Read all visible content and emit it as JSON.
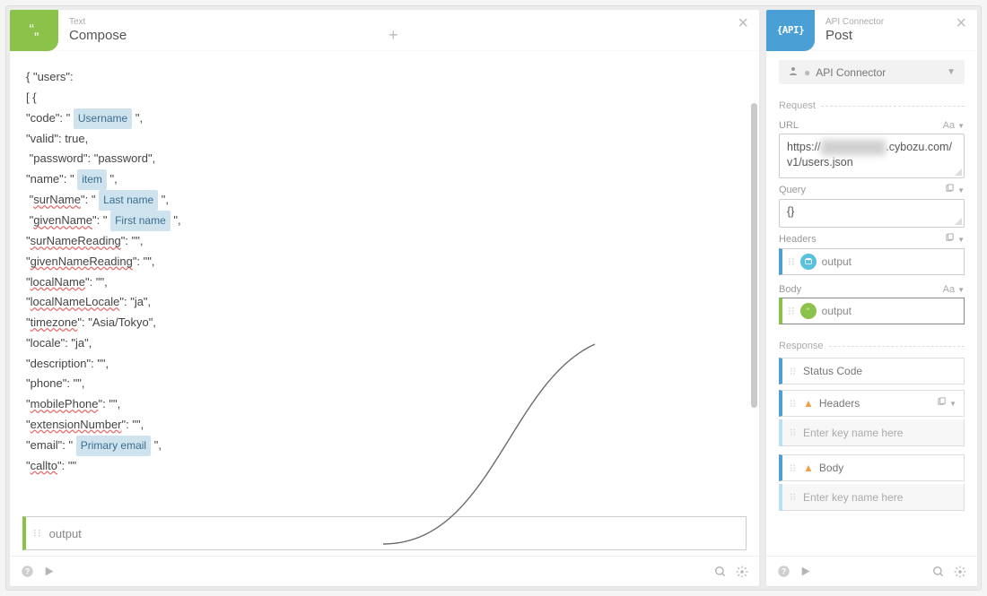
{
  "left": {
    "category": "Text",
    "title": "Compose",
    "lines": [
      {
        "pre": "{ \"users\":"
      },
      {
        "pre": "[ {"
      },
      {
        "pre": "\"code\": \" ",
        "token": "Username",
        "post": " \","
      },
      {
        "pre": "\"valid\": true,"
      },
      {
        "pre": " \"password\": \"password\","
      },
      {
        "pre": "\"name\": \" ",
        "token": "item",
        "post": " \","
      },
      {
        "pre": " \"",
        "err": "surName",
        "mid": "\": \" ",
        "token": "Last name",
        "post": " \","
      },
      {
        "pre": " \"",
        "err": "givenName",
        "mid": "\": \" ",
        "token": "First name",
        "post": " \","
      },
      {
        "pre": "\"",
        "err": "surNameReading",
        "mid": "\": \"\","
      },
      {
        "pre": "\"",
        "err": "givenNameReading",
        "mid": "\": \"\","
      },
      {
        "pre": "\"",
        "err": "localName",
        "mid": "\": \"\","
      },
      {
        "pre": "\"",
        "err": "localNameLocale",
        "mid": "\": \"ja\","
      },
      {
        "pre": "\"",
        "err": "timezone",
        "mid": "\": \"Asia/Tokyo\","
      },
      {
        "pre": "\"locale\": \"ja\","
      },
      {
        "pre": "\"description\": \"\","
      },
      {
        "pre": "\"phone\": \"\","
      },
      {
        "pre": "\"",
        "err": "mobilePhone",
        "mid": "\": \"\","
      },
      {
        "pre": "\"",
        "err": "extensionNumber",
        "mid": "\": \"\","
      },
      {
        "pre": "\"email\": \" ",
        "token": "Primary email",
        "post": " \","
      },
      {
        "pre": "\"",
        "err": "callto",
        "mid": "\": \"\""
      }
    ],
    "output_label": "output"
  },
  "right": {
    "category": "API Connector",
    "title": "Post",
    "connector_select": "API Connector",
    "section_request": "Request",
    "url_label": "URL",
    "url_value_pre": "https://",
    "url_value_post": ".cybozu.com/v1/users.json",
    "query_label": "Query",
    "query_value": "{}",
    "headers_label": "Headers",
    "headers_output": "output",
    "body_label": "Body",
    "body_output": "output",
    "section_response": "Response",
    "status_code": "Status Code",
    "headers_resp": "Headers",
    "body_resp": "Body",
    "key_placeholder": "Enter key name here"
  },
  "aa_label": "Aa",
  "plus": "+"
}
